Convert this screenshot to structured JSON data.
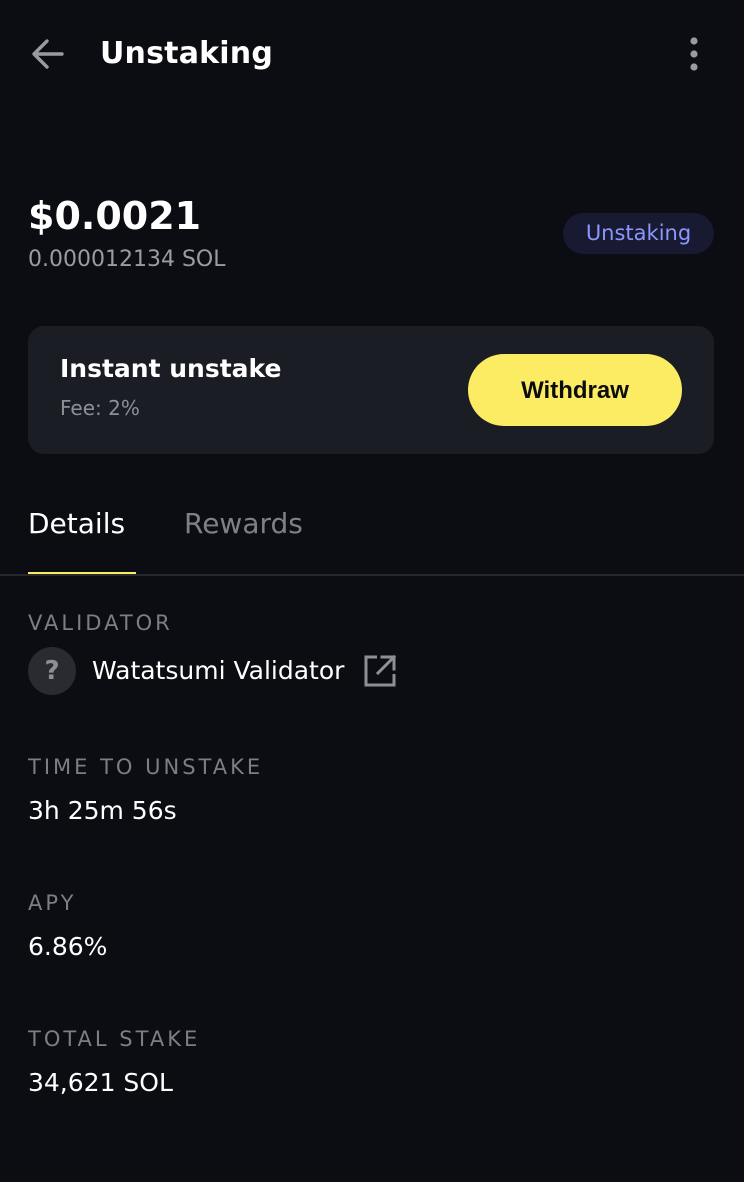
{
  "header": {
    "title": "Unstaking",
    "back_icon": "arrow-left-icon",
    "more_icon": "more-vertical-icon"
  },
  "balance": {
    "usd": "$0.0021",
    "sol": "0.000012134 SOL"
  },
  "status": {
    "label": "Unstaking",
    "color": "#8b97ff"
  },
  "instant_unstake": {
    "title": "Instant unstake",
    "fee": "Fee: 2%",
    "button_label": "Withdraw",
    "button_color": "#fbec64"
  },
  "tabs": [
    {
      "label": "Details",
      "active": true
    },
    {
      "label": "Rewards",
      "active": false
    }
  ],
  "details": {
    "validator": {
      "label": "VALIDATOR",
      "avatar_glyph": "?",
      "name": "Watatsumi Validator",
      "link_icon": "external-link-icon"
    },
    "time_to_unstake": {
      "label": "TIME TO UNSTAKE",
      "value": "3h 25m 56s"
    },
    "apy": {
      "label": "APY",
      "value": "6.86%"
    },
    "total_stake": {
      "label": "TOTAL STAKE",
      "value": "34,621 SOL"
    }
  },
  "colors": {
    "background": "#0c0d12",
    "card": "#1b1d24",
    "accent": "#fbec64"
  }
}
